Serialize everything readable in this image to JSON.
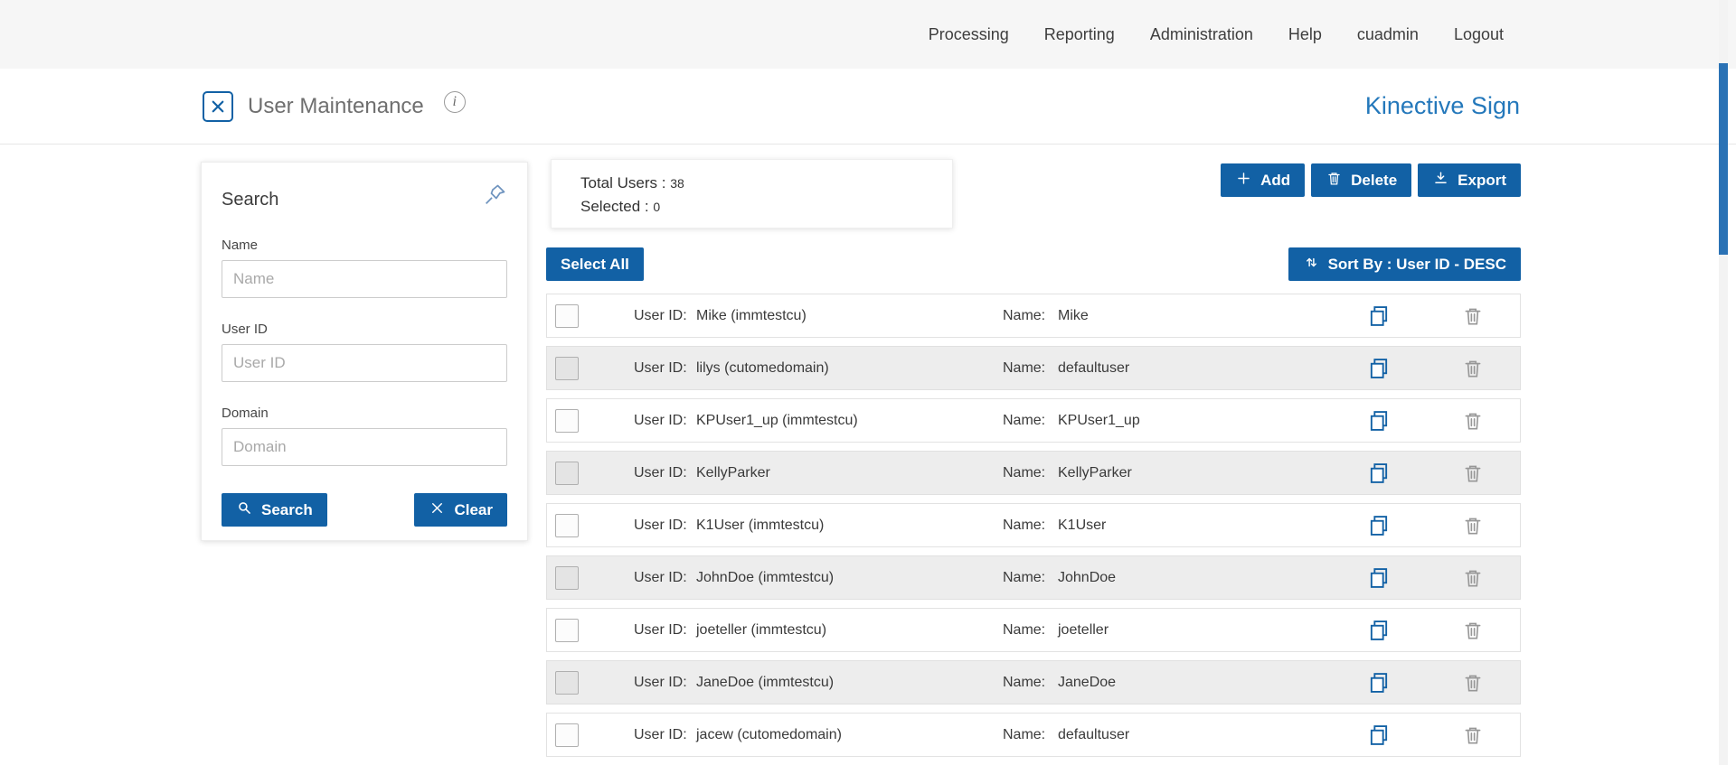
{
  "colors": {
    "accent": "#1261a5",
    "brand_blue": "#2478bb",
    "row_alt": "#ededed"
  },
  "nav": {
    "items": [
      "Processing",
      "Reporting",
      "Administration",
      "Help",
      "cuadmin",
      "Logout"
    ]
  },
  "header": {
    "title": "User Maintenance",
    "brand": "Kinective Sign"
  },
  "search_panel": {
    "title": "Search",
    "fields": [
      {
        "label": "Name",
        "placeholder": "Name",
        "value": ""
      },
      {
        "label": "User ID",
        "placeholder": "User ID",
        "value": ""
      },
      {
        "label": "Domain",
        "placeholder": "Domain",
        "value": ""
      }
    ],
    "search_button": "Search",
    "clear_button": "Clear"
  },
  "summary": {
    "total_label": "Total Users :",
    "total_value": "38",
    "selected_label": "Selected :",
    "selected_value": "0"
  },
  "toolbar": {
    "add": "Add",
    "delete": "Delete",
    "export": "Export",
    "select_all": "Select All",
    "sort_by": "Sort By : User ID - DESC"
  },
  "list": {
    "user_id_label": "User ID:",
    "name_label": "Name:",
    "rows": [
      {
        "user_id": "Mike (immtestcu)",
        "name": "Mike"
      },
      {
        "user_id": "lilys (cutomedomain)",
        "name": "defaultuser"
      },
      {
        "user_id": "KPUser1_up (immtestcu)",
        "name": "KPUser1_up"
      },
      {
        "user_id": "KellyParker",
        "name": "KellyParker"
      },
      {
        "user_id": "K1User (immtestcu)",
        "name": "K1User"
      },
      {
        "user_id": "JohnDoe (immtestcu)",
        "name": "JohnDoe"
      },
      {
        "user_id": "joeteller (immtestcu)",
        "name": "joeteller"
      },
      {
        "user_id": "JaneDoe (immtestcu)",
        "name": "JaneDoe"
      },
      {
        "user_id": "jacew (cutomedomain)",
        "name": "defaultuser"
      }
    ]
  }
}
